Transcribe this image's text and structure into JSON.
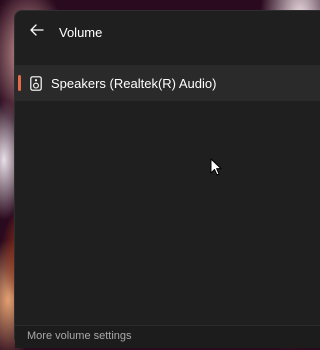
{
  "panel": {
    "title": "Volume",
    "back_icon": "arrow-left-icon"
  },
  "device": {
    "icon": "speaker-icon",
    "label": "Speakers (Realtek(R) Audio)",
    "accent_color": "#e56a4a"
  },
  "footer": {
    "link_label": "More volume settings"
  }
}
